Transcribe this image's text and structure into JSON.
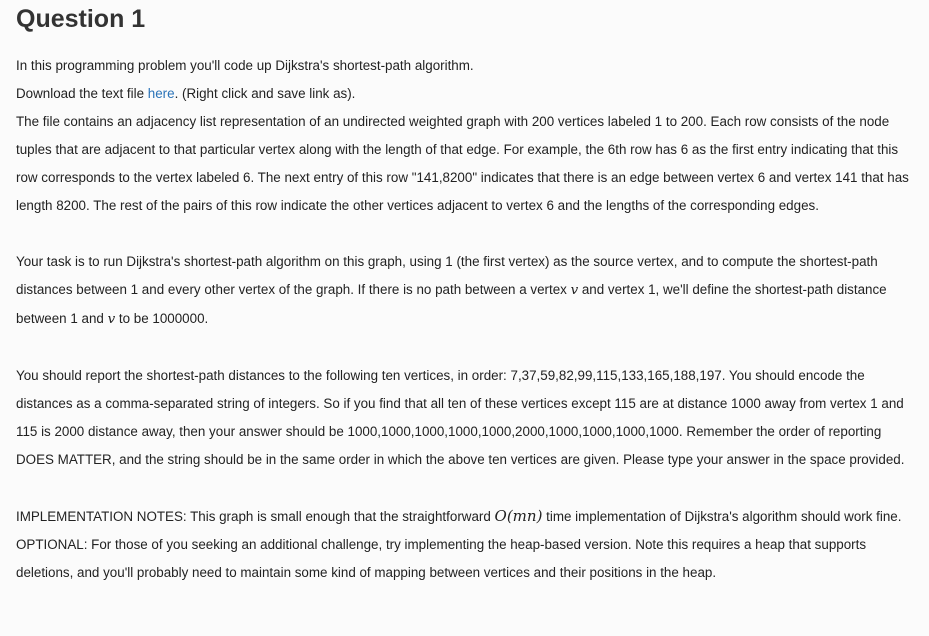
{
  "question": {
    "title": "Question 1",
    "intro": "In this programming problem you'll code up Dijkstra's shortest-path algorithm.",
    "download_prefix": "Download the text file ",
    "download_link": "here",
    "download_suffix": ". (Right click and save link as).",
    "p_file": "The file contains an adjacency list representation of an undirected weighted graph with 200 vertices labeled 1 to 200. Each row consists of the node tuples that are adjacent to that particular vertex along with the length of that edge. For example, the 6th row has 6 as the first entry indicating that this row corresponds to the vertex labeled 6. The next entry of this row \"141,8200\" indicates that there is an edge between vertex 6 and vertex 141 that has length 8200. The rest of the pairs of this row indicate the other vertices adjacent to vertex 6 and the lengths of the corresponding edges.",
    "task_part1": "Your task is to run Dijkstra's shortest-path algorithm on this graph, using 1 (the first vertex) as the source vertex, and to compute the shortest-path distances between 1 and every other vertex of the graph. If there is no path between a vertex ",
    "task_var1": "v",
    "task_part2": " and vertex 1, we'll define the shortest-path distance between 1 and ",
    "task_var2": "v",
    "task_part3": " to be 1000000.",
    "p_report": "You should report the shortest-path distances to the following ten vertices, in order: 7,37,59,82,99,115,133,165,188,197. You should encode the distances as a comma-separated string of integers. So if you find that all ten of these vertices except 115 are at distance 1000 away from vertex 1 and 115 is 2000 distance away, then your answer should be 1000,1000,1000,1000,1000,2000,1000,1000,1000,1000. Remember the order of reporting DOES MATTER, and the string should be in the same order in which the above ten vertices are given. Please type your answer in the space provided.",
    "impl_part1": "IMPLEMENTATION NOTES: This graph is small enough that the straightforward ",
    "impl_math": "O(mn)",
    "impl_part2": " time implementation of Dijkstra's algorithm should work fine. OPTIONAL: For those of you seeking an additional challenge, try implementing the heap-based version. Note this requires a heap that supports deletions, and you'll probably need to maintain some kind of mapping between vertices and their positions in the heap."
  },
  "colors": {
    "link": "#2a73b8",
    "text": "#222222",
    "title": "#333333",
    "background": "#fbfbfb"
  }
}
